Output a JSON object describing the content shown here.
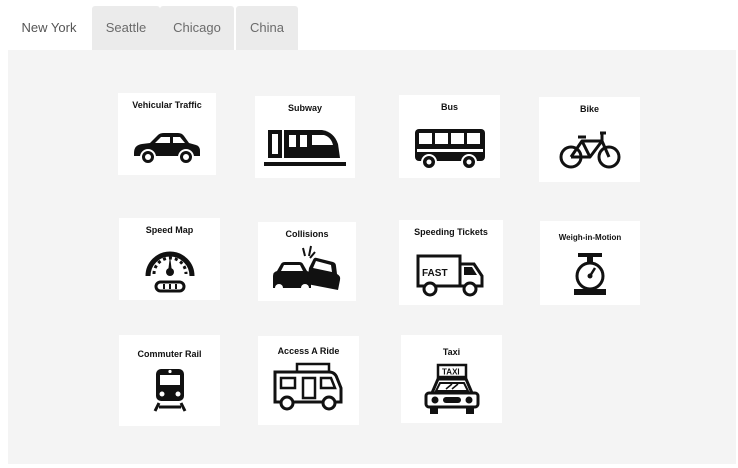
{
  "tabs": [
    {
      "label": "New York",
      "active": true
    },
    {
      "label": "Seattle",
      "active": false
    },
    {
      "label": "Chicago",
      "active": false
    },
    {
      "label": "China",
      "active": false
    }
  ],
  "cards": [
    {
      "title": "Vehicular Traffic",
      "icon": "car-icon"
    },
    {
      "title": "Subway",
      "icon": "subway-train-icon"
    },
    {
      "title": "Bus",
      "icon": "bus-icon"
    },
    {
      "title": "Bike",
      "icon": "bicycle-icon"
    },
    {
      "title": "Speed Map",
      "icon": "speedometer-icon"
    },
    {
      "title": "Collisions",
      "icon": "car-collision-icon"
    },
    {
      "title": "Speeding Tickets",
      "icon": "fast-truck-icon"
    },
    {
      "title": "Weigh-in-Motion",
      "icon": "scale-icon"
    },
    {
      "title": "Commuter Rail",
      "icon": "train-icon"
    },
    {
      "title": "Access A Ride",
      "icon": "camper-van-icon"
    },
    {
      "title": "Taxi",
      "icon": "taxi-icon"
    }
  ],
  "icon_text": {
    "fast": "FAST",
    "taxi": "TAXI"
  }
}
